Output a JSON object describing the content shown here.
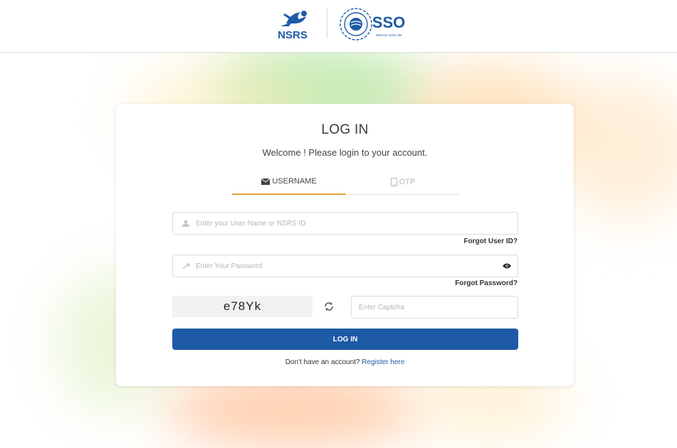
{
  "header": {
    "logo_left_text": "NSRS",
    "logo_right_text": "SSO",
    "logo_right_subtext": "SINGLE SIGN ON",
    "brand_color": "#1f5aa6"
  },
  "login": {
    "title": "LOG IN",
    "subtitle": "Welcome ! Please login to your account.",
    "tabs": [
      {
        "label": "USERNAME",
        "icon": "envelope-icon",
        "active": true
      },
      {
        "label": "OTP",
        "icon": "phone-icon",
        "active": false
      }
    ],
    "username_placeholder": "Enter your User Name or NSRS ID",
    "forgot_user_label": "Forgot User ID?",
    "password_placeholder": "Enter Your Password",
    "forgot_password_label": "Forgot Password?",
    "captcha_text": "e78Yk",
    "captcha_placeholder": "Enter Captcha",
    "submit_label": "LOG IN",
    "register_prompt": "Don't have an account?",
    "register_link": "Register here"
  },
  "colors": {
    "primary": "#1f5aa6",
    "tab_active_underline": "#e6a23c"
  }
}
